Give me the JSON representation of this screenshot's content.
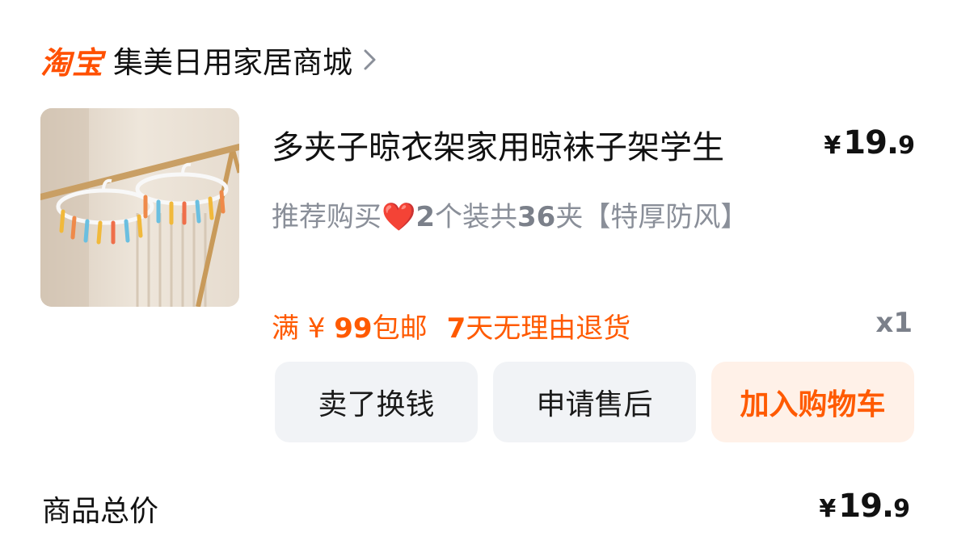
{
  "shop": {
    "platform_logo": "淘宝",
    "name": "集美日用家居商城"
  },
  "product": {
    "title": "多夹子晾衣架家用晾袜子架学生",
    "price_symbol": "¥",
    "price_int": "19.",
    "price_dec": "9",
    "desc_pre": "推荐购买",
    "desc_heart": "❤️",
    "desc_num1": "2",
    "desc_mid1": "个装共",
    "desc_num2": "36",
    "desc_post": "夹【特厚防风】",
    "promo_free_ship_prefix": "满 ¥ ",
    "promo_free_ship_num": "99",
    "promo_free_ship_suffix": "包邮",
    "promo_return_num": "7",
    "promo_return_text": "天无理由退货",
    "quantity": "x1"
  },
  "actions": {
    "sell": "卖了换钱",
    "after_sale": "申请售后",
    "add_cart": "加入购物车"
  },
  "total": {
    "label": "商品总价",
    "symbol": "¥",
    "int": "19.",
    "dec": "9"
  },
  "icons": {
    "chevron": "chevron-right-icon",
    "thumbnail": "product-thumbnail-image"
  }
}
